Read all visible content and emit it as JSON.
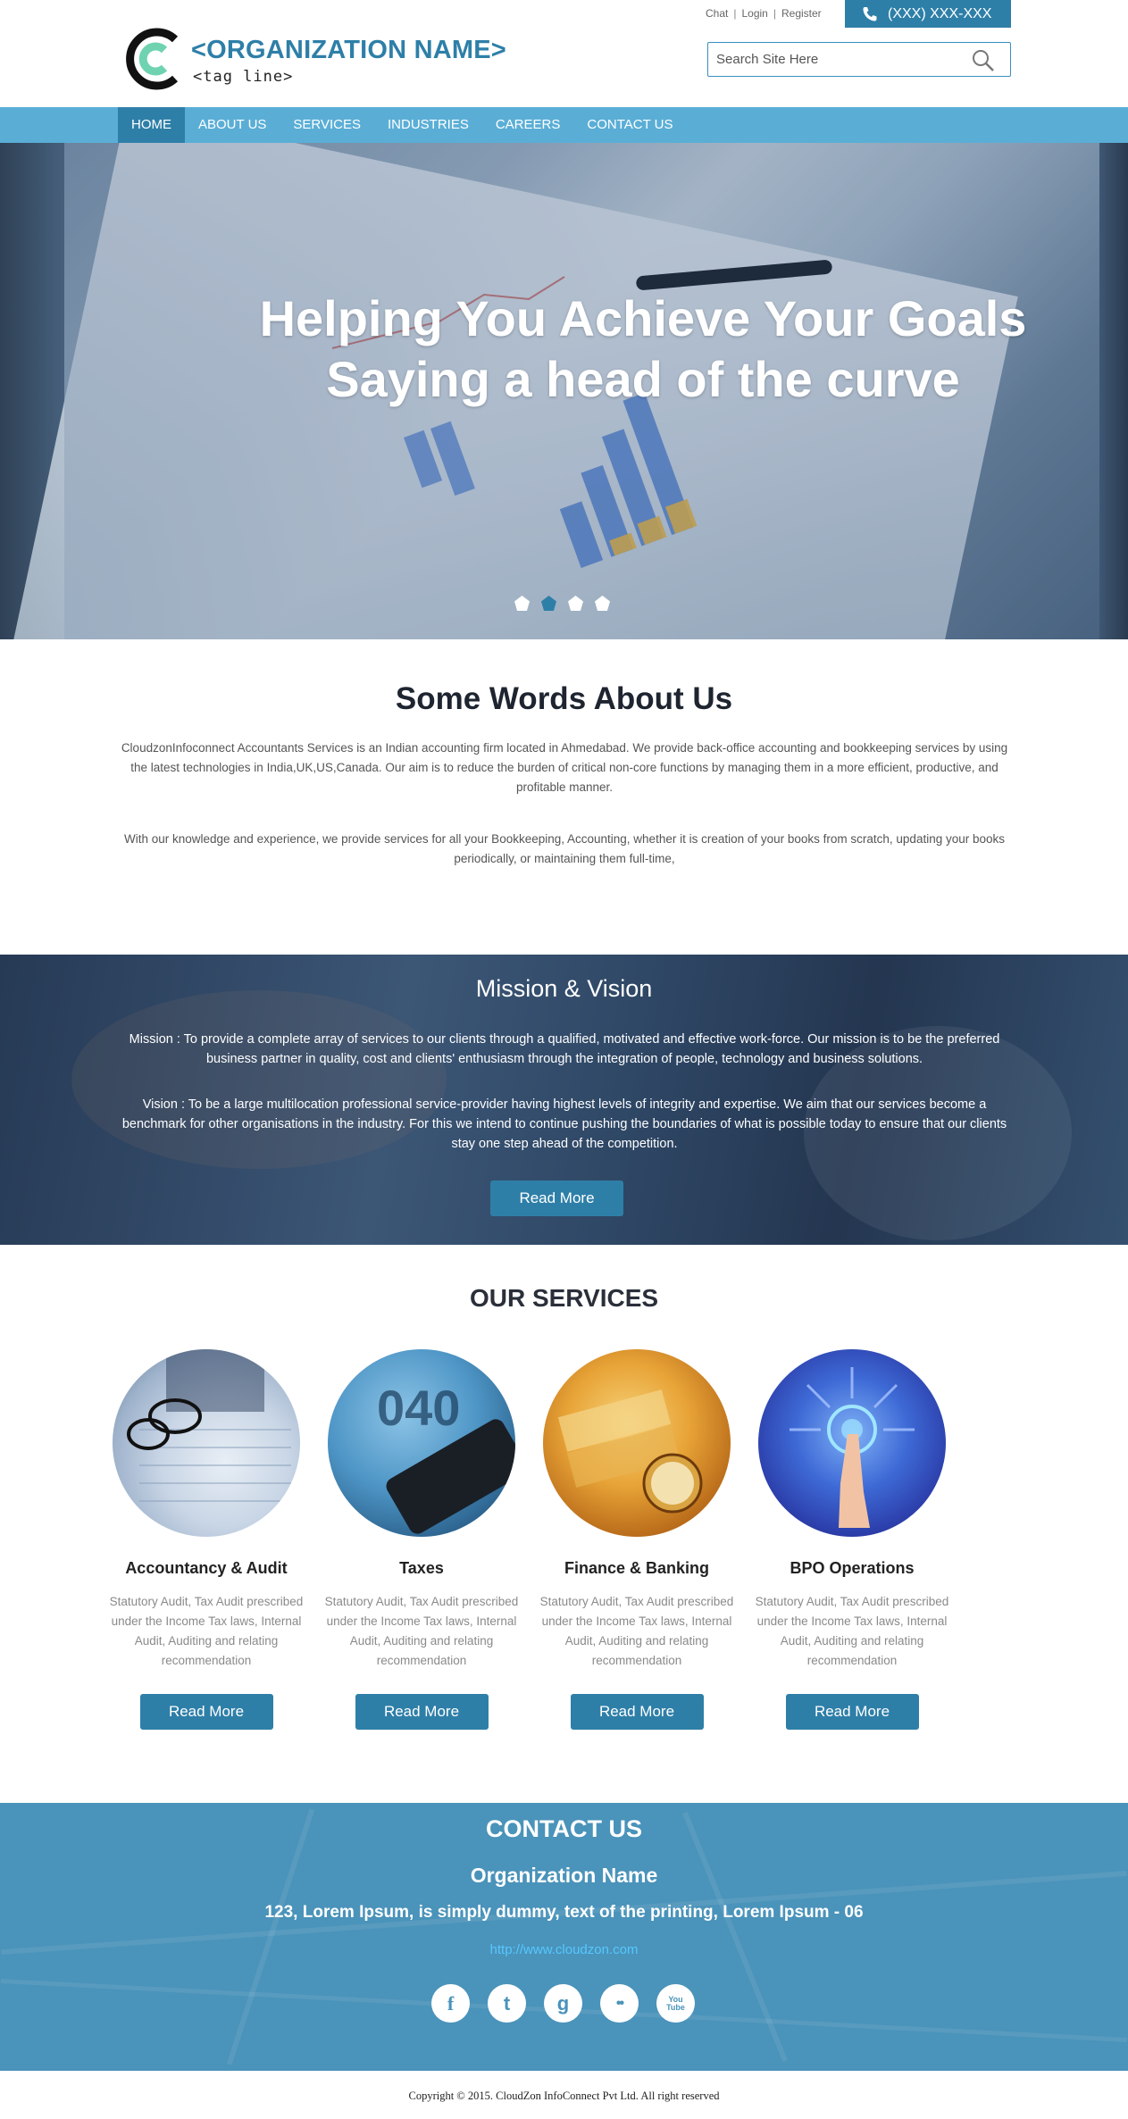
{
  "header": {
    "org_name": "<ORGANIZATION NAME>",
    "tagline": "<tag line>",
    "toplinks": [
      "Chat",
      "Login",
      "Register"
    ],
    "phone": "(XXX) XXX-XXX",
    "search_placeholder": "Search Site Here"
  },
  "nav": {
    "items": [
      "HOME",
      "ABOUT US",
      "SERVICES",
      "INDUSTRIES",
      "CAREERS",
      "CONTACT US"
    ],
    "active": "HOME"
  },
  "hero": {
    "line1": "Helping You Achieve Your Goals",
    "line2": "Saying a head of the curve",
    "slide_count": 4,
    "active_slide": 2
  },
  "about": {
    "title": "Some Words About Us",
    "p1": "CloudzonInfoconnect Accountants Services is an Indian accounting firm located in Ahmedabad. We provide back-office accounting and bookkeeping services by using the latest technologies in India,UK,US,Canada. Our aim is to reduce the burden of critical non-core functions by managing them in a more efficient, productive, and profitable manner.",
    "p2": "With our knowledge and experience, we provide services for all your Bookkeeping, Accounting, whether it is creation of your books from scratch, updating your books periodically, or maintaining them full-time,"
  },
  "mission": {
    "title": "Mission & Vision",
    "mission_text": "Mission : To provide a complete array of services to our clients through a qualified, motivated and effective work-force. Our mission is to be the preferred business partner in quality, cost and clients' enthusiasm through the integration of people, technology and business solutions.",
    "vision_text": "Vision : To be a large multilocation professional service-provider having highest levels of integrity and expertise. We aim that our services become a benchmark for other organisations in the industry. For this we intend to continue pushing the boundaries of what is possible today to ensure that our clients stay one step ahead of the competition.",
    "button": "Read More"
  },
  "services": {
    "title": "OUR SERVICES",
    "items": [
      {
        "name": "Accountancy & Audit",
        "desc": "Statutory Audit, Tax Audit prescribed under the Income Tax laws, Internal Audit, Auditing and relating recommendation",
        "button": "Read More"
      },
      {
        "name": "Taxes",
        "desc": "Statutory Audit, Tax Audit prescribed under the Income Tax laws, Internal Audit, Auditing and relating recommendation",
        "button": "Read More"
      },
      {
        "name": "Finance & Banking",
        "desc": "Statutory Audit, Tax Audit prescribed under the Income Tax laws, Internal Audit, Auditing and relating recommendation",
        "button": "Read More"
      },
      {
        "name": "BPO Operations",
        "desc": "Statutory Audit, Tax Audit prescribed under the Income Tax laws, Internal Audit, Auditing and relating recommendation",
        "button": "Read More"
      }
    ]
  },
  "contact": {
    "title": "CONTACT US",
    "org": "Organization Name",
    "address": "123, Lorem Ipsum, is simply dummy, text of the printing, Lorem Ipsum - 06",
    "url": "http://www.cloudzon.com",
    "social": [
      {
        "icon": "facebook-icon",
        "glyph": "f"
      },
      {
        "icon": "twitter-icon",
        "glyph": "t"
      },
      {
        "icon": "google-icon",
        "glyph": "g"
      },
      {
        "icon": "flickr-icon",
        "glyph": "••"
      },
      {
        "icon": "youtube-icon",
        "glyph": "You Tube"
      }
    ]
  },
  "footer": {
    "copyright": "Copyright © 2015. CloudZon InfoConnect Pvt Ltd. All right reserved"
  },
  "colors": {
    "brand_blue": "#2e7fa8",
    "nav_blue": "#5aaed6",
    "contact_bg": "#4a93ba",
    "logo_mint": "#6fd3b0"
  }
}
